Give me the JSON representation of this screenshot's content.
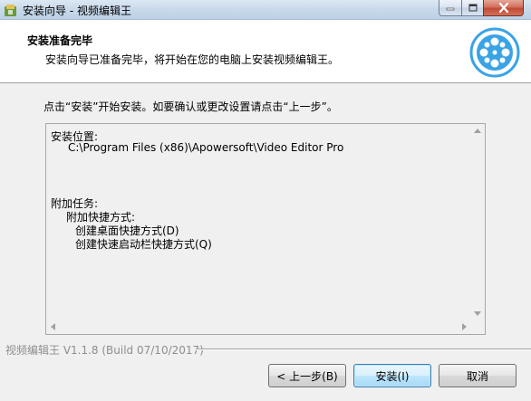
{
  "window": {
    "title": "安装向导 - 视频编辑王",
    "minimize_icon": "minimize-icon",
    "maximize_icon": "maximize-icon",
    "close_icon": "close-icon"
  },
  "header": {
    "title": "安装准备完毕",
    "subtitle": "安装向导已准备完毕，将开始在您的电脑上安装视频编辑王。",
    "logo_icon": "film-reel-icon",
    "logo_color": "#3aa3e6"
  },
  "body": {
    "instruction": "点击“安装”开始安装。如要确认或更改设置请点击“上一步”。",
    "memo": {
      "install_location_label": "安装位置:",
      "install_location_value": "C:\\Program Files (x86)\\Apowersoft\\Video Editor Pro",
      "tasks_label": "附加任务:",
      "shortcuts_label": "附加快捷方式:",
      "shortcut_desktop": "创建桌面快捷方式(D)",
      "shortcut_quicklaunch": "创建快速启动栏快捷方式(Q)"
    }
  },
  "footer": {
    "version": "视频编辑王 V1.1.8  (Build 07/10/2017)"
  },
  "buttons": {
    "back": "< 上一步(B)",
    "install": "安装(I)",
    "cancel": "取消"
  }
}
